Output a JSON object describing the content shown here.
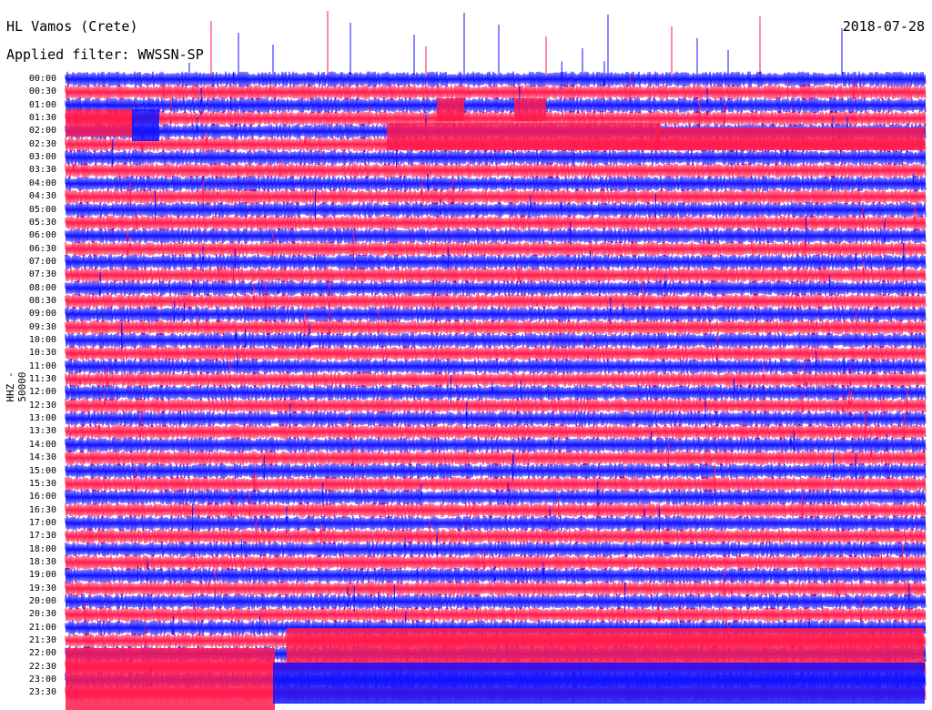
{
  "header": {
    "station": "HL Vamos (Crete)",
    "filter": "Applied filter: WWSSN-SP",
    "date": "2018-07-28"
  },
  "axis": {
    "ylabel": "HHZ - 50000"
  },
  "colors": {
    "trace_a": "#1010ff",
    "trace_b": "#ff1a4d",
    "background": "#ffffff"
  },
  "chart_data": {
    "type": "line",
    "title": "HL Vamos (Crete)",
    "ylabel": "HHZ - 50000",
    "row_labels": [
      "00:00",
      "00:30",
      "01:00",
      "01:30",
      "02:00",
      "02:30",
      "03:00",
      "03:30",
      "04:00",
      "04:30",
      "05:00",
      "05:30",
      "06:00",
      "06:30",
      "07:00",
      "07:30",
      "08:00",
      "08:30",
      "09:00",
      "09:30",
      "10:00",
      "10:30",
      "11:00",
      "11:30",
      "12:00",
      "12:30",
      "13:00",
      "13:30",
      "14:00",
      "14:30",
      "15:00",
      "15:30",
      "16:00",
      "16:30",
      "17:00",
      "17:30",
      "18:00",
      "18:30",
      "19:00",
      "19:30",
      "20:00",
      "20:30",
      "21:00",
      "21:30",
      "22:00",
      "22:30",
      "23:00",
      "23:30"
    ],
    "series": [
      {
        "color": "#1010ff"
      },
      {
        "color": "#ff1a4d"
      }
    ]
  }
}
